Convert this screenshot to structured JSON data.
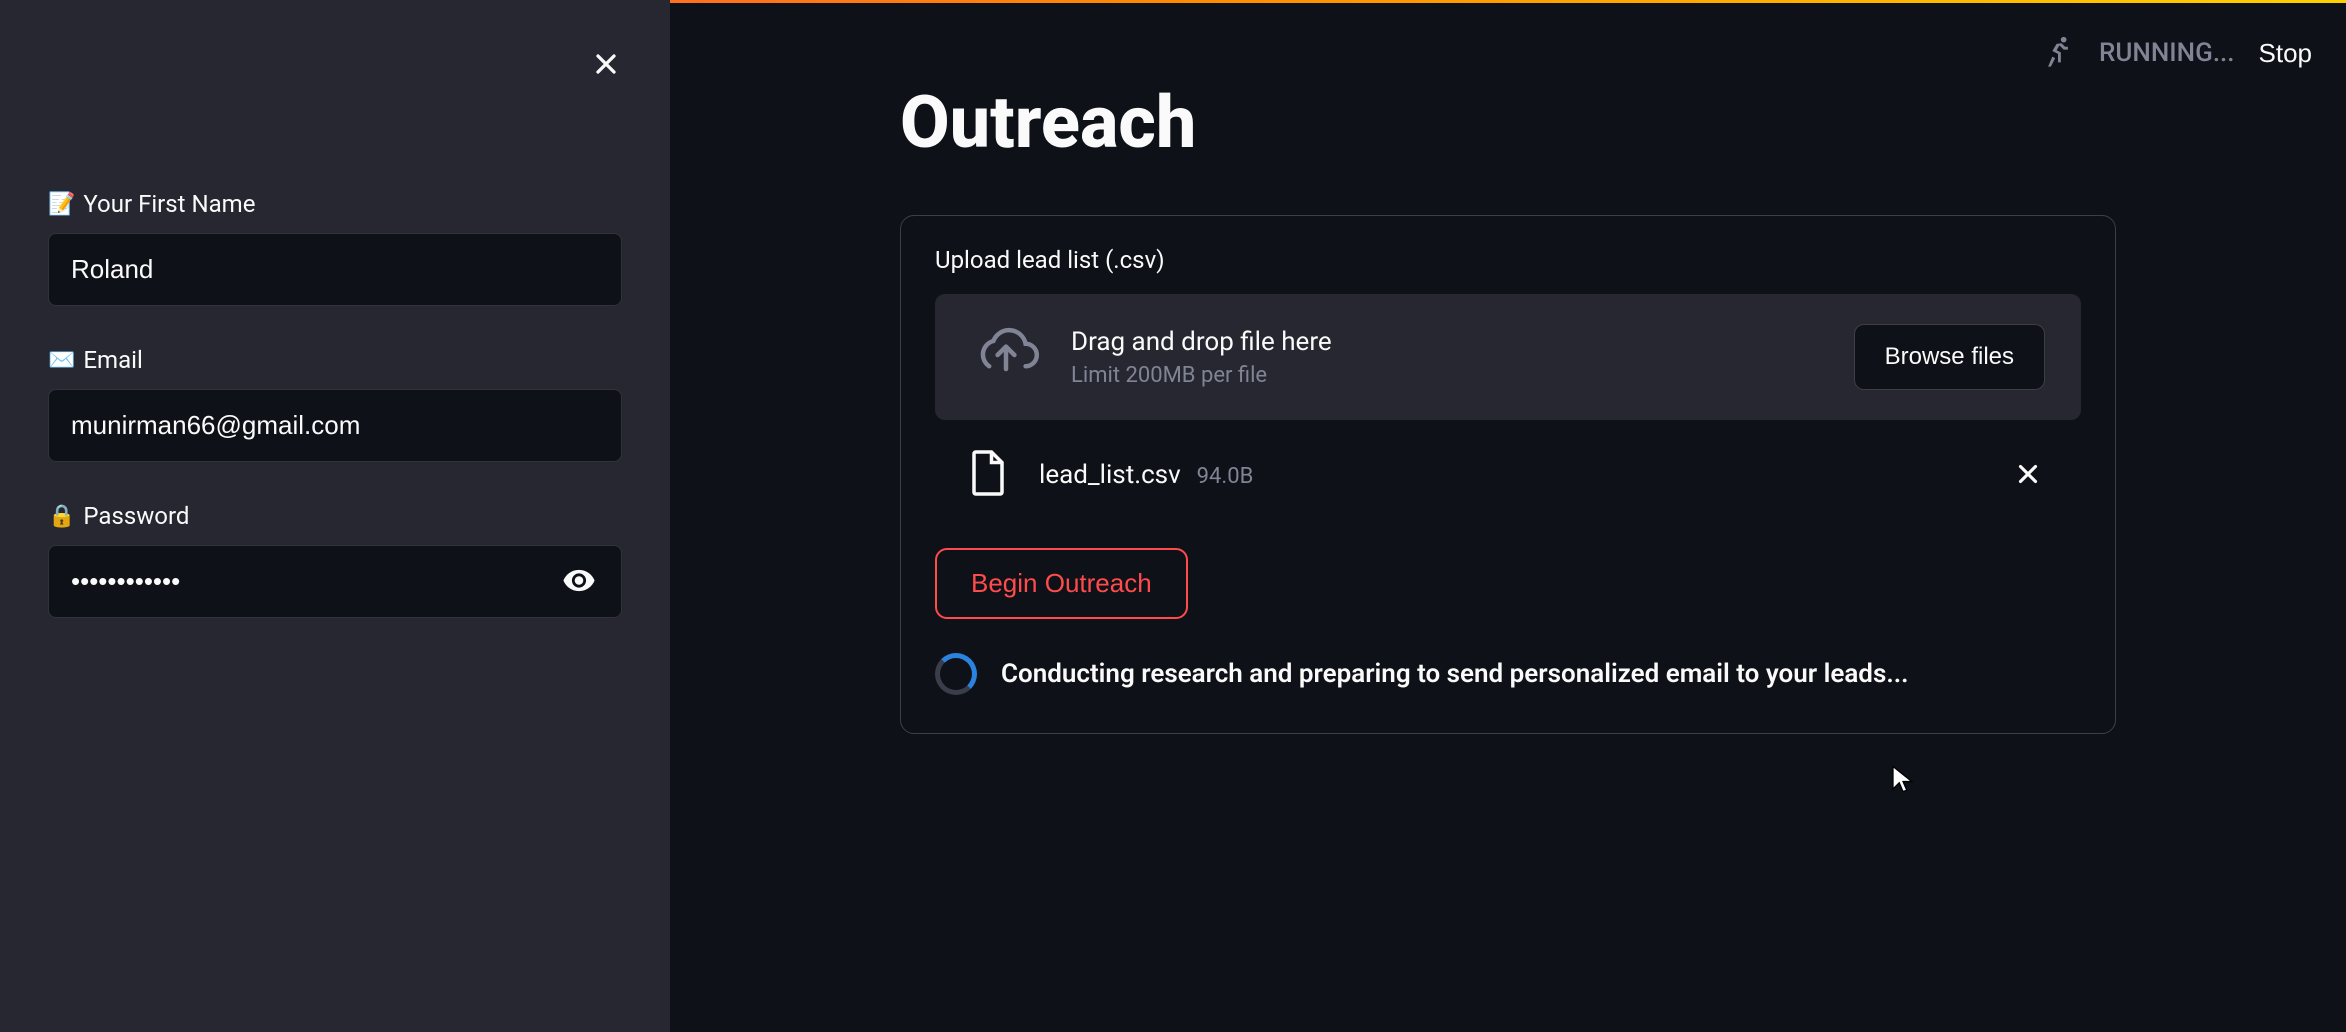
{
  "sidebar": {
    "first_name_label": "Your First Name",
    "first_name_value": "Roland",
    "email_label": "Email",
    "email_value": "munirman66@gmail.com",
    "password_label": "Password",
    "password_value": "••••••••••••"
  },
  "header": {
    "running_text": "RUNNING...",
    "stop_text": "Stop"
  },
  "page": {
    "title": "Outreach"
  },
  "upload": {
    "label": "Upload lead list (.csv)",
    "drop_title": "Drag and drop file here",
    "drop_sub": "Limit 200MB per file",
    "browse_label": "Browse files",
    "file_name": "lead_list.csv",
    "file_size": "94.0B"
  },
  "action": {
    "begin_label": "Begin Outreach",
    "status_text": "Conducting research and preparing to send personalized email to your leads..."
  },
  "icons": {
    "close": "close-icon",
    "eye": "eye-icon",
    "cloud": "cloud-upload-icon",
    "file": "file-icon",
    "running": "running-icon"
  }
}
